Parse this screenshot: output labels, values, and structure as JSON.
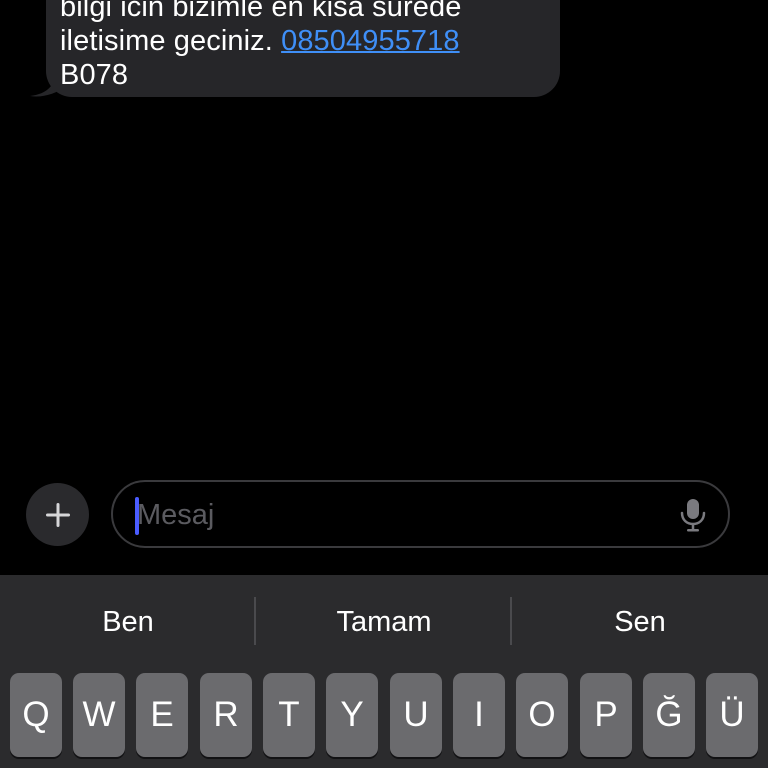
{
  "message": {
    "line1": "bilgi icin bizimle en kisa surede",
    "line2_text": "iletisime geciniz. ",
    "phone_link": "08504955718",
    "line3": "B078"
  },
  "composer": {
    "plus_symbol": "+",
    "placeholder": "Mesaj"
  },
  "suggestions": [
    "Ben",
    "Tamam",
    "Sen"
  ],
  "keyboard": {
    "row1": [
      "Q",
      "W",
      "E",
      "R",
      "T",
      "Y",
      "U",
      "I",
      "O",
      "P",
      "Ğ",
      "Ü"
    ]
  },
  "colors": {
    "background": "#000000",
    "bubble": "#262629",
    "link": "#3f8ff7",
    "caret": "#4a5cff",
    "keyboard": "#2b2b2d",
    "key": "#6b6b6e"
  }
}
